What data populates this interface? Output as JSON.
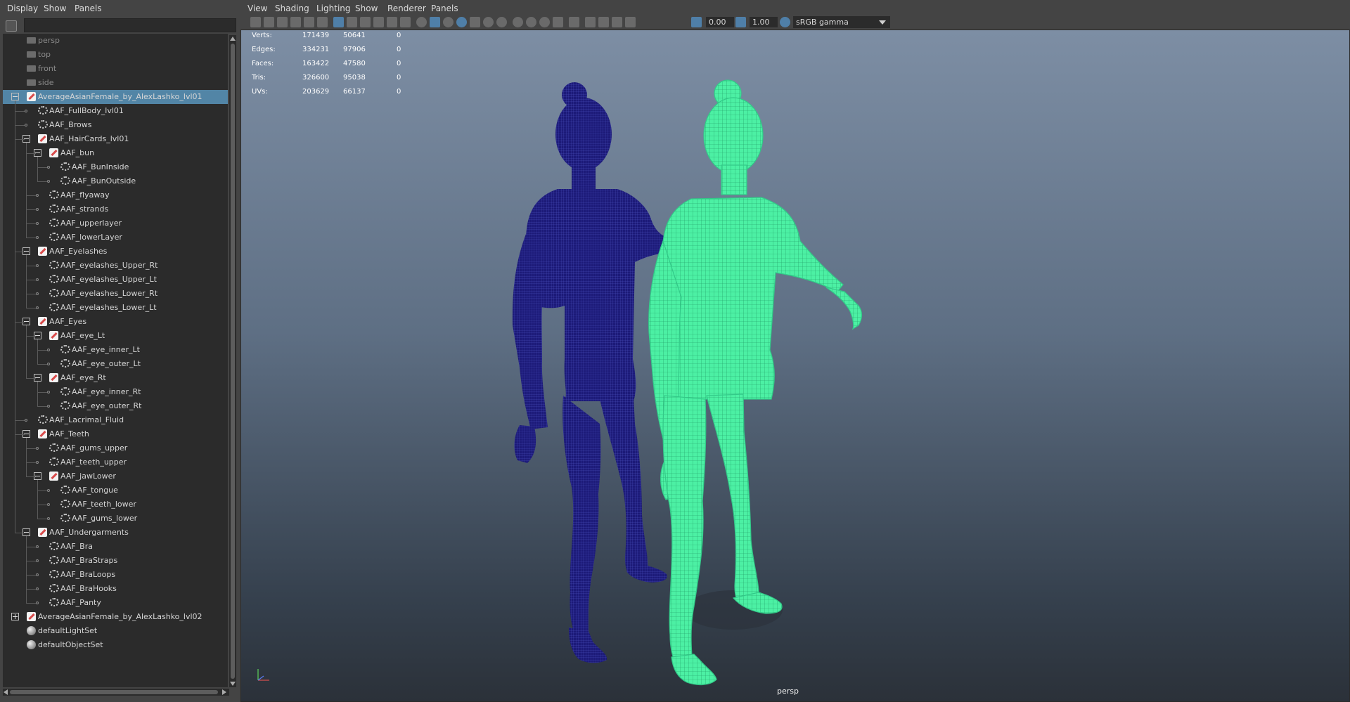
{
  "outliner": {
    "menu": [
      "Display",
      "Show",
      "Panels"
    ],
    "items": [
      {
        "label": "persp",
        "depth": 1,
        "kind": "camera"
      },
      {
        "label": "top",
        "depth": 1,
        "kind": "camera"
      },
      {
        "label": "front",
        "depth": 1,
        "kind": "camera"
      },
      {
        "label": "side",
        "depth": 1,
        "kind": "camera"
      },
      {
        "label": "AverageAsianFemale_by_AlexLashko_lvl01",
        "depth": 1,
        "kind": "group",
        "toggle": "minus",
        "selected": true
      },
      {
        "label": "AAF_FullBody_lvl01",
        "depth": 2,
        "kind": "mesh"
      },
      {
        "label": "AAF_Brows",
        "depth": 2,
        "kind": "mesh"
      },
      {
        "label": "AAF_HairCards_lvl01",
        "depth": 2,
        "kind": "group",
        "toggle": "minus"
      },
      {
        "label": "AAF_bun",
        "depth": 3,
        "kind": "group",
        "toggle": "minus"
      },
      {
        "label": "AAF_BunInside",
        "depth": 4,
        "kind": "mesh"
      },
      {
        "label": "AAF_BunOutside",
        "depth": 4,
        "kind": "mesh"
      },
      {
        "label": "AAF_flyaway",
        "depth": 3,
        "kind": "mesh"
      },
      {
        "label": "AAF_strands",
        "depth": 3,
        "kind": "mesh"
      },
      {
        "label": "AAF_upperlayer",
        "depth": 3,
        "kind": "mesh"
      },
      {
        "label": "AAF_lowerLayer",
        "depth": 3,
        "kind": "mesh"
      },
      {
        "label": "AAF_Eyelashes",
        "depth": 2,
        "kind": "group",
        "toggle": "minus"
      },
      {
        "label": "AAF_eyelashes_Upper_Rt",
        "depth": 3,
        "kind": "mesh"
      },
      {
        "label": "AAF_eyelashes_Upper_Lt",
        "depth": 3,
        "kind": "mesh"
      },
      {
        "label": "AAF_eyelashes_Lower_Rt",
        "depth": 3,
        "kind": "mesh"
      },
      {
        "label": "AAF_eyelashes_Lower_Lt",
        "depth": 3,
        "kind": "mesh"
      },
      {
        "label": "AAF_Eyes",
        "depth": 2,
        "kind": "group",
        "toggle": "minus"
      },
      {
        "label": "AAF_eye_Lt",
        "depth": 3,
        "kind": "group",
        "toggle": "minus"
      },
      {
        "label": "AAF_eye_inner_Lt",
        "depth": 4,
        "kind": "mesh"
      },
      {
        "label": "AAF_eye_outer_Lt",
        "depth": 4,
        "kind": "mesh"
      },
      {
        "label": "AAF_eye_Rt",
        "depth": 3,
        "kind": "group",
        "toggle": "minus"
      },
      {
        "label": "AAF_eye_inner_Rt",
        "depth": 4,
        "kind": "mesh"
      },
      {
        "label": "AAF_eye_outer_Rt",
        "depth": 4,
        "kind": "mesh"
      },
      {
        "label": "AAF_Lacrimal_Fluid",
        "depth": 2,
        "kind": "mesh"
      },
      {
        "label": "AAF_Teeth",
        "depth": 2,
        "kind": "group",
        "toggle": "minus"
      },
      {
        "label": "AAF_gums_upper",
        "depth": 3,
        "kind": "mesh"
      },
      {
        "label": "AAF_teeth_upper",
        "depth": 3,
        "kind": "mesh"
      },
      {
        "label": "AAF_jawLower",
        "depth": 3,
        "kind": "group",
        "toggle": "minus"
      },
      {
        "label": "AAF_tongue",
        "depth": 4,
        "kind": "mesh"
      },
      {
        "label": "AAF_teeth_lower",
        "depth": 4,
        "kind": "mesh"
      },
      {
        "label": "AAF_gums_lower",
        "depth": 4,
        "kind": "mesh"
      },
      {
        "label": "AAF_Undergarments",
        "depth": 2,
        "kind": "group",
        "toggle": "minus"
      },
      {
        "label": "AAF_Bra",
        "depth": 3,
        "kind": "mesh"
      },
      {
        "label": "AAF_BraStraps",
        "depth": 3,
        "kind": "mesh"
      },
      {
        "label": "AAF_BraLoops",
        "depth": 3,
        "kind": "mesh"
      },
      {
        "label": "AAF_BraHooks",
        "depth": 3,
        "kind": "mesh"
      },
      {
        "label": "AAF_Panty",
        "depth": 3,
        "kind": "mesh"
      },
      {
        "label": "AverageAsianFemale_by_AlexLashko_lvl02",
        "depth": 1,
        "kind": "group",
        "toggle": "plus"
      },
      {
        "label": "defaultLightSet",
        "depth": 1,
        "kind": "set"
      },
      {
        "label": "defaultObjectSet",
        "depth": 1,
        "kind": "set"
      }
    ]
  },
  "viewport": {
    "menu": [
      "View",
      "Shading",
      "Lighting",
      "Show",
      "Renderer",
      "Panels"
    ],
    "exposure": "0.00",
    "gamma": "1.00",
    "color_space": "sRGB gamma",
    "camera_label": "persp",
    "hud": [
      {
        "label": "Verts:",
        "a": "171439",
        "b": "50641",
        "c": "0"
      },
      {
        "label": "Edges:",
        "a": "334231",
        "b": "97906",
        "c": "0"
      },
      {
        "label": "Faces:",
        "a": "163422",
        "b": "47580",
        "c": "0"
      },
      {
        "label": "Tris:",
        "a": "326600",
        "b": "95038",
        "c": "0"
      },
      {
        "label": "UVs:",
        "a": "203629",
        "b": "66137",
        "c": "0"
      }
    ],
    "wire_colors": {
      "selected_model": "#4cf0a4",
      "other_model": "#1c1a78"
    }
  }
}
